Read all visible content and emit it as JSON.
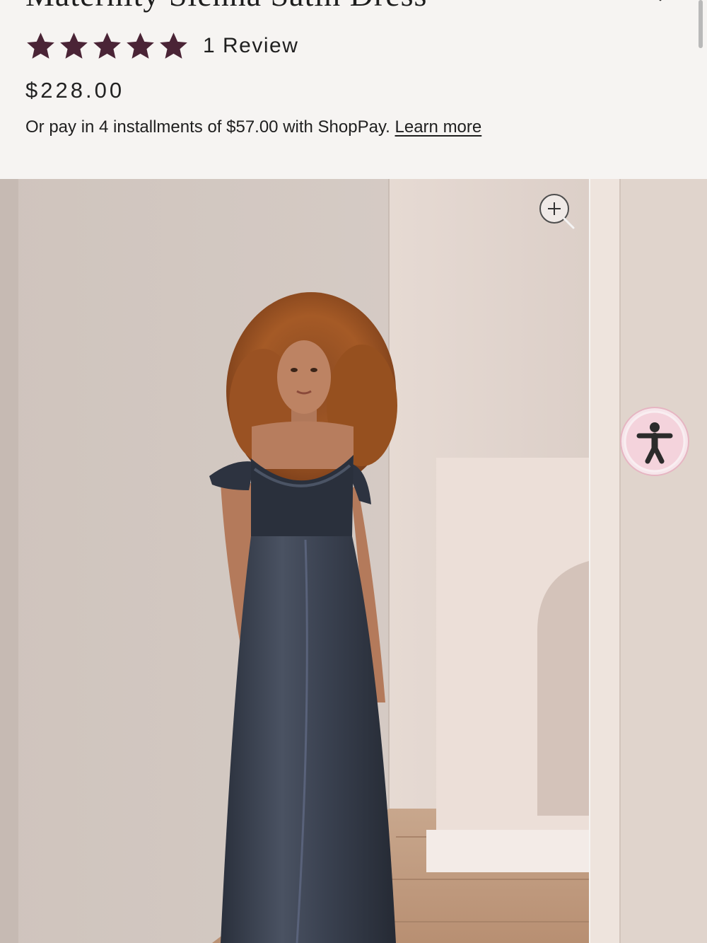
{
  "product": {
    "title": "Maternity Sienna Satin Dress",
    "rating": 5,
    "rating_max": 5,
    "review_count_label": "1 Review",
    "price": "$228.00",
    "installment_text": "Or pay in 4 installments of $57.00 with ShopPay.",
    "learn_more_label": "Learn more"
  },
  "icons": {
    "wishlist": "heart-icon",
    "star": "star-icon",
    "zoom": "zoom-in-icon",
    "accessibility": "accessibility-icon"
  },
  "colors": {
    "page_background": "#f6f4f2",
    "star_fill": "#4a2436",
    "accessibility_button": "#f4d3dc",
    "dress": "#3a4150"
  },
  "gallery": {
    "current_image": "woman in navy off-shoulder satin maxi dress"
  }
}
